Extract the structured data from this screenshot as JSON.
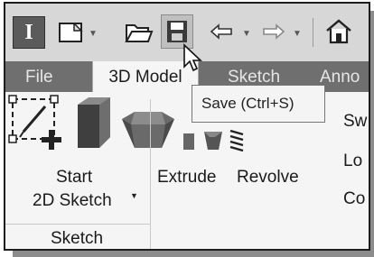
{
  "quick_access": {
    "app_letter": "I",
    "icons": [
      "new-file-icon",
      "open-folder-icon",
      "save-icon",
      "undo-icon",
      "redo-icon",
      "home-icon"
    ]
  },
  "tabs": [
    {
      "label": "File",
      "active": false
    },
    {
      "label": "3D Model",
      "active": true
    },
    {
      "label": "Sketch",
      "active": false
    },
    {
      "label": "Anno",
      "active": false
    }
  ],
  "tooltip": {
    "text": "Save (Ctrl+S)"
  },
  "ribbon": {
    "start_sketch": {
      "line1": "Start",
      "line2": "2D Sketch"
    },
    "group_label": "Sketch",
    "extrude": "Extrude",
    "revolve": "Revolve",
    "side_items": [
      "Sw",
      "Lo",
      "Co"
    ]
  },
  "colors": {
    "toolbar_bg": "#d7d7d7",
    "tab_bar_bg": "#6f6f6f",
    "panel_bg": "#f5f5f5",
    "app_button": "#5b5b5b"
  }
}
